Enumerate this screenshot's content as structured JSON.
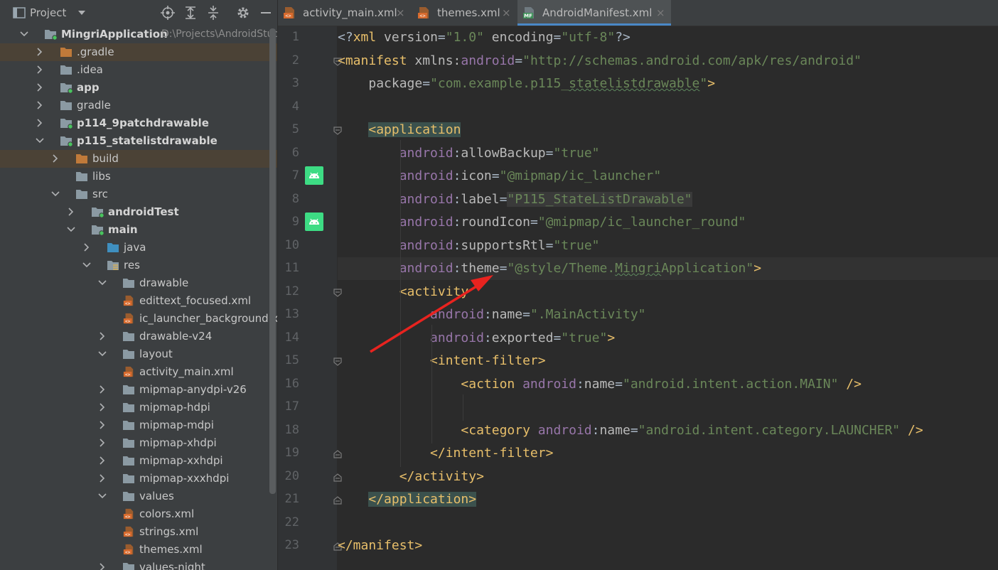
{
  "project_panel": {
    "title": "Project",
    "toolbar_icons": [
      "locate-icon",
      "expand-all-icon",
      "collapse-all-icon",
      "gear-icon",
      "minimize-icon"
    ],
    "tree": [
      {
        "label": "MingriApplication",
        "path": "D:\\Projects\\AndroidStudio",
        "depth": 0,
        "expanded": true,
        "bold": true,
        "icon": "module-folder-icon"
      },
      {
        "label": ".gradle",
        "depth": 1,
        "expanded": false,
        "icon": "orange-folder-icon",
        "selected": true
      },
      {
        "label": ".idea",
        "depth": 1,
        "expanded": false,
        "icon": "folder-icon"
      },
      {
        "label": "app",
        "depth": 1,
        "expanded": false,
        "bold": true,
        "icon": "module-folder-icon"
      },
      {
        "label": "gradle",
        "depth": 1,
        "expanded": false,
        "icon": "folder-icon"
      },
      {
        "label": "p114_9patchdrawable",
        "depth": 1,
        "expanded": false,
        "bold": true,
        "icon": "module-folder-icon"
      },
      {
        "label": "p115_statelistdrawable",
        "depth": 1,
        "expanded": true,
        "bold": true,
        "icon": "module-folder-icon"
      },
      {
        "label": "build",
        "depth": 2,
        "expanded": false,
        "icon": "orange-folder-icon",
        "selected": true
      },
      {
        "label": "libs",
        "depth": 2,
        "leaf": true,
        "icon": "folder-icon"
      },
      {
        "label": "src",
        "depth": 2,
        "expanded": true,
        "icon": "folder-icon"
      },
      {
        "label": "androidTest",
        "depth": 3,
        "expanded": false,
        "bold": true,
        "icon": "module-folder-icon"
      },
      {
        "label": "main",
        "depth": 3,
        "expanded": true,
        "bold": true,
        "icon": "module-folder-icon"
      },
      {
        "label": "java",
        "depth": 4,
        "expanded": false,
        "icon": "blue-folder-icon"
      },
      {
        "label": "res",
        "depth": 4,
        "expanded": true,
        "icon": "res-folder-icon"
      },
      {
        "label": "drawable",
        "depth": 5,
        "expanded": true,
        "icon": "folder-icon"
      },
      {
        "label": "edittext_focused.xml",
        "depth": 6,
        "leaf": true,
        "icon": "xml-file-icon"
      },
      {
        "label": "ic_launcher_background.xml",
        "depth": 6,
        "leaf": true,
        "icon": "xml-file-icon"
      },
      {
        "label": "drawable-v24",
        "depth": 5,
        "expanded": false,
        "icon": "folder-icon"
      },
      {
        "label": "layout",
        "depth": 5,
        "expanded": true,
        "icon": "folder-icon"
      },
      {
        "label": "activity_main.xml",
        "depth": 6,
        "leaf": true,
        "icon": "xml-file-icon"
      },
      {
        "label": "mipmap-anydpi-v26",
        "depth": 5,
        "expanded": false,
        "icon": "folder-icon"
      },
      {
        "label": "mipmap-hdpi",
        "depth": 5,
        "expanded": false,
        "icon": "folder-icon"
      },
      {
        "label": "mipmap-mdpi",
        "depth": 5,
        "expanded": false,
        "icon": "folder-icon"
      },
      {
        "label": "mipmap-xhdpi",
        "depth": 5,
        "expanded": false,
        "icon": "folder-icon"
      },
      {
        "label": "mipmap-xxhdpi",
        "depth": 5,
        "expanded": false,
        "icon": "folder-icon"
      },
      {
        "label": "mipmap-xxxhdpi",
        "depth": 5,
        "expanded": false,
        "icon": "folder-icon"
      },
      {
        "label": "values",
        "depth": 5,
        "expanded": true,
        "icon": "folder-icon"
      },
      {
        "label": "colors.xml",
        "depth": 6,
        "leaf": true,
        "icon": "xml-file-icon"
      },
      {
        "label": "strings.xml",
        "depth": 6,
        "leaf": true,
        "icon": "xml-file-icon"
      },
      {
        "label": "themes.xml",
        "depth": 6,
        "leaf": true,
        "icon": "xml-file-icon"
      },
      {
        "label": "values-night",
        "depth": 5,
        "expanded": false,
        "icon": "folder-icon"
      }
    ]
  },
  "tabs": [
    {
      "label": "activity_main.xml",
      "icon": "xml-file-icon",
      "active": false
    },
    {
      "label": "themes.xml",
      "icon": "xml-file-icon",
      "active": false
    },
    {
      "label": "AndroidManifest.xml",
      "icon": "manifest-file-icon",
      "icon_text": "MF",
      "active": true
    }
  ],
  "tab_close_glyph": "×",
  "editor": {
    "current_line": 11,
    "gutter_android_icon_lines": [
      7,
      9
    ],
    "fold_marker_lines": [
      2,
      5,
      12,
      15,
      19,
      20,
      21,
      23
    ],
    "lines": [
      {
        "n": "1",
        "parts": [
          [
            "p",
            "<?"
          ],
          [
            "t",
            "xml "
          ],
          [
            "at",
            "version"
          ],
          [
            "p",
            "="
          ],
          [
            "v",
            "\"1.0\""
          ],
          [
            "p",
            " "
          ],
          [
            "at",
            "encoding"
          ],
          [
            "p",
            "="
          ],
          [
            "v",
            "\"utf-8\""
          ],
          [
            "p",
            "?>"
          ]
        ]
      },
      {
        "n": "2",
        "parts": [
          [
            "t",
            "<manifest "
          ],
          [
            "at",
            "xmlns:"
          ],
          [
            "ns",
            "android"
          ],
          [
            "p",
            "="
          ],
          [
            "v",
            "\"http://schemas.android.com/apk/res/android\""
          ]
        ]
      },
      {
        "n": "3",
        "parts": [
          [
            "p",
            "    "
          ],
          [
            "at",
            "package"
          ],
          [
            "p",
            "="
          ],
          [
            "v",
            "\"com.example.p115_"
          ],
          [
            "vsq",
            "statelistdrawable"
          ],
          [
            "v",
            "\""
          ],
          [
            "t",
            ">"
          ]
        ]
      },
      {
        "n": "4",
        "parts": []
      },
      {
        "n": "5",
        "parts": [
          [
            "p",
            "    "
          ],
          [
            "thl",
            "<application"
          ]
        ]
      },
      {
        "n": "6",
        "parts": [
          [
            "p",
            "        "
          ],
          [
            "ns",
            "android"
          ],
          [
            "p",
            ":"
          ],
          [
            "at",
            "allowBackup"
          ],
          [
            "p",
            "="
          ],
          [
            "v",
            "\"true\""
          ]
        ]
      },
      {
        "n": "7",
        "parts": [
          [
            "p",
            "        "
          ],
          [
            "ns",
            "android"
          ],
          [
            "p",
            ":"
          ],
          [
            "at",
            "icon"
          ],
          [
            "p",
            "="
          ],
          [
            "v",
            "\"@mipmap/ic_launcher\""
          ]
        ]
      },
      {
        "n": "8",
        "parts": [
          [
            "p",
            "        "
          ],
          [
            "ns",
            "android"
          ],
          [
            "p",
            ":"
          ],
          [
            "at",
            "label"
          ],
          [
            "p",
            "="
          ],
          [
            "vbox",
            "\"P115_StateListDrawable\""
          ]
        ]
      },
      {
        "n": "9",
        "parts": [
          [
            "p",
            "        "
          ],
          [
            "ns",
            "android"
          ],
          [
            "p",
            ":"
          ],
          [
            "at",
            "roundIcon"
          ],
          [
            "p",
            "="
          ],
          [
            "v",
            "\"@mipmap/ic_launcher_round\""
          ]
        ]
      },
      {
        "n": "10",
        "parts": [
          [
            "p",
            "        "
          ],
          [
            "ns",
            "android"
          ],
          [
            "p",
            ":"
          ],
          [
            "at",
            "supportsRtl"
          ],
          [
            "p",
            "="
          ],
          [
            "v",
            "\"true\""
          ]
        ]
      },
      {
        "n": "11",
        "parts": [
          [
            "p",
            "        "
          ],
          [
            "ns",
            "android"
          ],
          [
            "p",
            ":"
          ],
          [
            "at",
            "theme"
          ],
          [
            "p",
            "="
          ],
          [
            "v",
            "\"@style/Theme."
          ],
          [
            "vsq",
            "Mingri"
          ],
          [
            "v",
            "Application\""
          ],
          [
            "t",
            ">"
          ]
        ]
      },
      {
        "n": "12",
        "parts": [
          [
            "p",
            "        "
          ],
          [
            "t",
            "<activity"
          ]
        ]
      },
      {
        "n": "13",
        "parts": [
          [
            "p",
            "            "
          ],
          [
            "ns",
            "android"
          ],
          [
            "p",
            ":"
          ],
          [
            "at",
            "name"
          ],
          [
            "p",
            "="
          ],
          [
            "v",
            "\".MainActivity\""
          ]
        ]
      },
      {
        "n": "14",
        "parts": [
          [
            "p",
            "            "
          ],
          [
            "ns",
            "android"
          ],
          [
            "p",
            ":"
          ],
          [
            "at",
            "exported"
          ],
          [
            "p",
            "="
          ],
          [
            "v",
            "\"true\""
          ],
          [
            "t",
            ">"
          ]
        ]
      },
      {
        "n": "15",
        "parts": [
          [
            "p",
            "            "
          ],
          [
            "t",
            "<intent-filter>"
          ]
        ]
      },
      {
        "n": "16",
        "parts": [
          [
            "p",
            "                "
          ],
          [
            "t",
            "<action "
          ],
          [
            "ns",
            "android"
          ],
          [
            "p",
            ":"
          ],
          [
            "at",
            "name"
          ],
          [
            "p",
            "="
          ],
          [
            "v",
            "\"android.intent.action.MAIN\""
          ],
          [
            "p",
            " "
          ],
          [
            "t",
            "/>"
          ]
        ]
      },
      {
        "n": "17",
        "parts": []
      },
      {
        "n": "18",
        "parts": [
          [
            "p",
            "                "
          ],
          [
            "t",
            "<category "
          ],
          [
            "ns",
            "android"
          ],
          [
            "p",
            ":"
          ],
          [
            "at",
            "name"
          ],
          [
            "p",
            "="
          ],
          [
            "v",
            "\"android.intent.category.LAUNCHER\""
          ],
          [
            "p",
            " "
          ],
          [
            "t",
            "/>"
          ]
        ]
      },
      {
        "n": "19",
        "parts": [
          [
            "p",
            "            "
          ],
          [
            "t",
            "</intent-filter>"
          ]
        ]
      },
      {
        "n": "20",
        "parts": [
          [
            "p",
            "        "
          ],
          [
            "t",
            "</activity>"
          ]
        ]
      },
      {
        "n": "21",
        "parts": [
          [
            "p",
            "    "
          ],
          [
            "thl",
            "</application>"
          ]
        ]
      },
      {
        "n": "22",
        "parts": []
      },
      {
        "n": "23",
        "parts": [
          [
            "t",
            "</manifest>"
          ]
        ]
      }
    ]
  },
  "annotation_arrow_color": "#e8231f",
  "colors": {
    "tag": "#e8bf6a",
    "namespace": "#9876aa",
    "attribute": "#bababa",
    "value": "#6a8759",
    "plain": "#a9b7c6",
    "line_number": "#606366"
  }
}
